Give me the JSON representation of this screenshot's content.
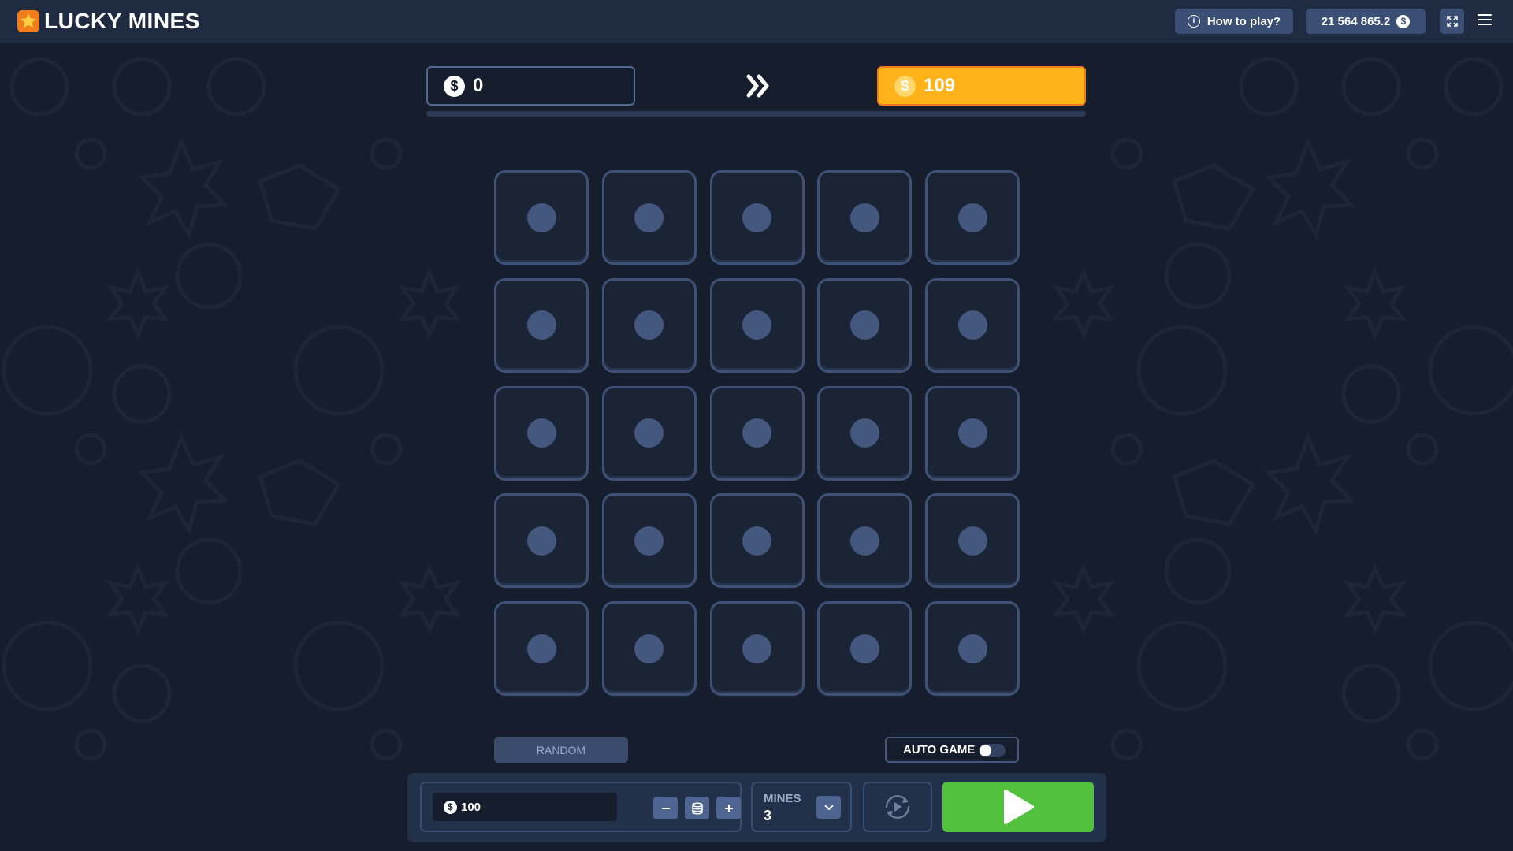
{
  "header": {
    "title": "LUCKY MINES",
    "how_to_play_label": "How to play?",
    "balance": "21 564 865.2",
    "currency_symbol": "$"
  },
  "multipliers": {
    "current": "0",
    "next": "109"
  },
  "progress": 0,
  "grid": {
    "rows": 5,
    "cols": 5
  },
  "controls": {
    "random_label": "RANDOM",
    "auto_game_label": "AUTO GAME",
    "auto_game_enabled": false
  },
  "bet": {
    "value": "100",
    "currency_symbol": "$"
  },
  "mines": {
    "label": "MINES",
    "value": "3"
  },
  "colors": {
    "accent": "#ffb21a",
    "play": "#52c13e",
    "cell_border": "#3e5176",
    "background": "#161d2c"
  },
  "icons": [
    "star-logo-icon",
    "info-icon",
    "dollar-coin-icon",
    "fullscreen-icon",
    "menu-icon",
    "double-chevron-right-icon",
    "minus-icon",
    "coin-stack-icon",
    "plus-icon",
    "chevron-down-icon",
    "auto-play-icon",
    "play-icon"
  ]
}
